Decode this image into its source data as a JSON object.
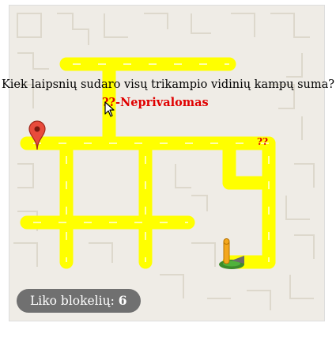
{
  "question": {
    "text": "Kiek laipsnių sudaro visų trikampio vidinių kampų suma?",
    "optional_label": "??-Neprivalomas",
    "marker_label": "??"
  },
  "status": {
    "blocks_left_label": "Liko blokelių:",
    "blocks_left_count": "6"
  },
  "colors": {
    "background": "#efece6",
    "road": "#ffff00",
    "road_edge": "#e6e600",
    "wall_line": "#ddd8cc",
    "error_text": "#e00000",
    "pill_bg": "#707070"
  },
  "icons": {
    "start": "map-pin-icon",
    "player": "pegman-icon",
    "pointer": "mouse-cursor-icon"
  }
}
